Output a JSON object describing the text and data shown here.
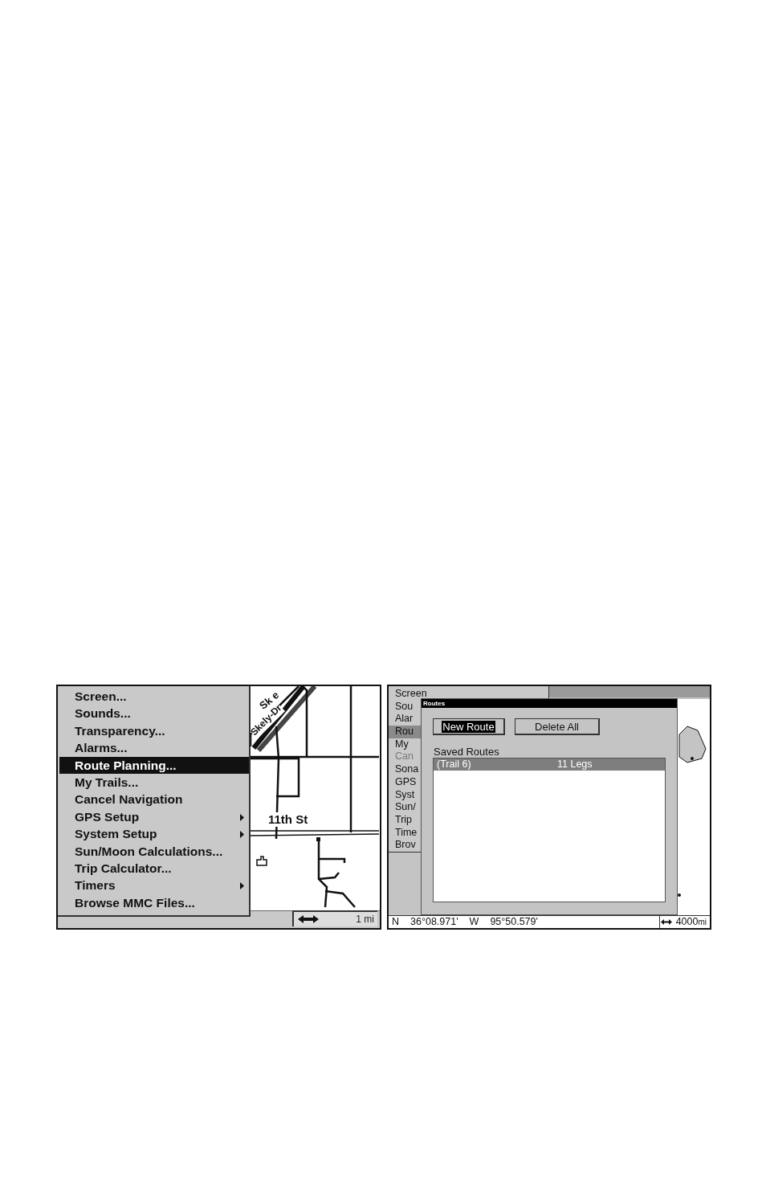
{
  "screens": [
    {
      "kind": "map_menu",
      "menu": {
        "items": [
          {
            "label": "Screen...",
            "selected": false,
            "submenu": false
          },
          {
            "label": "Sounds...",
            "selected": false,
            "submenu": false
          },
          {
            "label": "Transparency...",
            "selected": false,
            "submenu": false
          },
          {
            "label": "Alarms...",
            "selected": false,
            "submenu": false
          },
          {
            "label": "Route Planning...",
            "selected": true,
            "submenu": false
          },
          {
            "label": "My Trails...",
            "selected": false,
            "submenu": false
          },
          {
            "label": "Cancel Navigation",
            "selected": false,
            "submenu": false
          },
          {
            "label": "GPS Setup",
            "selected": false,
            "submenu": true
          },
          {
            "label": "System Setup",
            "selected": false,
            "submenu": true
          },
          {
            "label": "Sun/Moon Calculations...",
            "selected": false,
            "submenu": false
          },
          {
            "label": "Trip Calculator...",
            "selected": false,
            "submenu": false
          },
          {
            "label": "Timers",
            "selected": false,
            "submenu": true
          },
          {
            "label": "Browse MMC Files...",
            "selected": false,
            "submenu": false
          }
        ]
      },
      "map": {
        "road_labels": [
          "Sk e",
          "Skely-Dr"
        ],
        "street_label": "11th St"
      },
      "status_bar": {
        "scale": "1 mi"
      }
    },
    {
      "kind": "routes_dialog",
      "menu": {
        "items": [
          {
            "label": "Screen",
            "selected": false,
            "disabled": false
          },
          {
            "label": "Sou",
            "selected": false,
            "disabled": false
          },
          {
            "label": "Alar",
            "selected": false,
            "disabled": false
          },
          {
            "label": "Rou",
            "selected": true,
            "disabled": false
          },
          {
            "label": "My",
            "selected": false,
            "disabled": false
          },
          {
            "label": "Can",
            "selected": false,
            "disabled": true
          },
          {
            "label": "Sona",
            "selected": false,
            "disabled": false
          },
          {
            "label": "GPS",
            "selected": false,
            "disabled": false
          },
          {
            "label": "Syst",
            "selected": false,
            "disabled": false
          },
          {
            "label": "Sun/",
            "selected": false,
            "disabled": false
          },
          {
            "label": "Trip",
            "selected": false,
            "disabled": false
          },
          {
            "label": "Time",
            "selected": false,
            "disabled": false
          },
          {
            "label": "Brov",
            "selected": false,
            "disabled": false
          }
        ]
      },
      "dialog": {
        "title": "Routes",
        "buttons": [
          {
            "label": "New Route",
            "selected": true
          },
          {
            "label": "Delete All",
            "selected": false
          }
        ],
        "list_label": "Saved Routes",
        "routes": [
          {
            "name": "(Trail 6)",
            "legs": "11 Legs",
            "selected": true
          }
        ]
      },
      "status_bar": {
        "lat_hemisphere": "N",
        "latitude": "36°08.971'",
        "lon_hemisphere": "W",
        "longitude": "95°50.579'",
        "scale": "4000",
        "unit": "mi"
      }
    }
  ]
}
